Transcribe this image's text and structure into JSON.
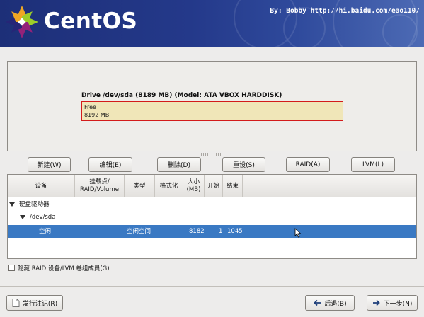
{
  "header": {
    "brand": "CentOS",
    "credit": "By: Bobby http://hi.baidu.com/eao110/"
  },
  "drive": {
    "title": "Drive /dev/sda (8189 MB) (Model: ATA VBOX HARDDISK)",
    "free_label": "Free",
    "free_size": "8192 MB"
  },
  "actions": {
    "new": "新建(W)",
    "edit": "编辑(E)",
    "delete": "删除(D)",
    "reset": "重设(S)",
    "raid": "RAID(A)",
    "lvm": "LVM(L)"
  },
  "table": {
    "columns": [
      "设备",
      "挂载点/\nRAID/Volume",
      "类型",
      "格式化",
      "大小\n(MB)",
      "开始",
      "结束"
    ],
    "rows": [
      {
        "device": "硬盘驱动器",
        "mount": "",
        "type": "",
        "format": "",
        "size": "",
        "start": "",
        "end": ""
      },
      {
        "device": "/dev/sda",
        "mount": "",
        "type": "",
        "format": "",
        "size": "",
        "start": "",
        "end": ""
      },
      {
        "device": "空闲",
        "mount": "",
        "type": "空闲空间",
        "format": "",
        "size": "8182",
        "start": "1",
        "end": "1045"
      }
    ]
  },
  "options": {
    "hide_raid_lvm": "隐藏 RAID 设备/LVM 卷组成员(G)",
    "hide_raid_lvm_checked": false
  },
  "footer": {
    "release_notes": "发行注记(R)",
    "back": "后退(B)",
    "next": "下一步(N)"
  },
  "colors": {
    "banner": "#24398a",
    "selection": "#3a79c3",
    "free_border": "#d31b1b",
    "free_fill": "#f0e6b8"
  }
}
